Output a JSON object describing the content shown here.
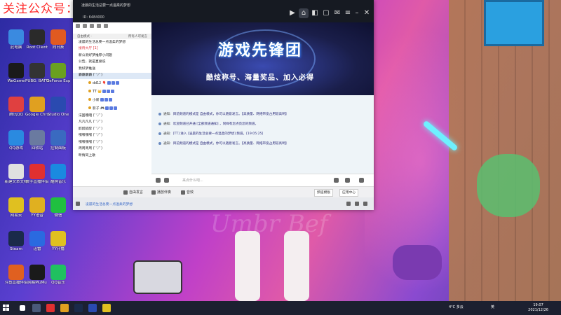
{
  "banner": {
    "text": "关注公众号：果佳兴，领红包买新鲜水果"
  },
  "desktop_icons": [
    {
      "label": "此电脑",
      "color": "#3a8ae0"
    },
    {
      "label": "Root Client",
      "color": "#2a2a2a"
    },
    {
      "label": "向日葵",
      "color": "#e05a20"
    },
    {
      "label": "WeGame",
      "color": "#1a1a1a"
    },
    {
      "label": "PUBG: BATTLEGR...",
      "color": "#333333"
    },
    {
      "label": "GeForce Experience",
      "color": "#6aa020"
    },
    {
      "label": "腾讯QQ",
      "color": "#e04040"
    },
    {
      "label": "Google Chrome",
      "color": "#e0a020"
    },
    {
      "label": "Studio One",
      "color": "#2a4ab0"
    },
    {
      "label": "QQ游戏",
      "color": "#2a8ae0"
    },
    {
      "label": "回收站",
      "color": "#6a7aa0"
    },
    {
      "label": "控制面板",
      "color": "#3a6ac0"
    },
    {
      "label": "新建文本文档",
      "color": "#e0e0e0"
    },
    {
      "label": "快手直播伴侣",
      "color": "#e03030"
    },
    {
      "label": "酷狗音乐",
      "color": "#1a8ae0"
    },
    {
      "label": "网易云",
      "color": "#e0c020"
    },
    {
      "label": "YY语音",
      "color": "#e0b020"
    },
    {
      "label": "微信",
      "color": "#20c040"
    },
    {
      "label": "Steam",
      "color": "#1a2a4a"
    },
    {
      "label": "迅雷",
      "color": "#2a6ae0"
    },
    {
      "label": "YY开播",
      "color": "#e0c020"
    },
    {
      "label": "斗鱼直播伴侣",
      "color": "#e06020"
    },
    {
      "label": "网易MuMu",
      "color": "#1a1a1a"
    },
    {
      "label": "QQ音乐",
      "color": "#20c060"
    }
  ],
  "window": {
    "room_name": "凌晨的生活总要一点温柔的梦想",
    "room_id": "ID:  6484000",
    "controls": [
      "play-icon",
      "home-icon",
      "gamepad-icon",
      "chat-icon",
      "mail-icon",
      "settings-icon",
      "minimize-icon",
      "maximize-icon",
      "close-icon"
    ]
  },
  "left_panel": {
    "mode_label": "自由模式 ·",
    "mode_right": "所有人可发言",
    "channels": [
      {
        "name": "凌晨的生活总要一点温柔的梦想",
        "type": "top"
      },
      {
        "name": "接待大厅 [1]",
        "type": "hot"
      },
      {
        "name": "新公测好梦推荐小问题",
        "type": "top"
      },
      {
        "name": "公告，就是直接说",
        "type": "top"
      },
      {
        "name": "我好梦推送",
        "type": "top"
      },
      {
        "name": "霸霸霸霸 (ﾟ▽ﾟ)",
        "type": "active"
      },
      {
        "name": "dd12 🎈",
        "type": "sub"
      },
      {
        "name": "TT 👑",
        "type": "sub"
      },
      {
        "name": "小新",
        "type": "sub"
      },
      {
        "name": "影子 🎮",
        "type": "sub"
      },
      {
        "name": "法国嘎嘎 (ﾟ▽ﾟ)",
        "type": "top"
      },
      {
        "name": "凡凡凡凡 (ﾟ▽ﾟ)",
        "type": "top"
      },
      {
        "name": "醉醉醉醉 (ﾟ▽ﾟ)",
        "type": "top"
      },
      {
        "name": "嘿嘿嘿嘿 (ﾟ▽ﾟ)",
        "type": "top"
      },
      {
        "name": "嘿嘿嘿嘿 (ﾟ▽ﾟ)",
        "type": "top"
      },
      {
        "name": "周周周周 (ﾟ▽ﾟ)",
        "type": "top"
      },
      {
        "name": "昕情同上歌",
        "type": "top"
      }
    ]
  },
  "game_banner": {
    "title": "游戏先锋团",
    "subtitle": "酷炫称号、海量奖品、加入必得"
  },
  "messages": [
    {
      "label": "通知:",
      "text": "目前频道的模式是 自由模式，你可以随意发言。【高质量、网络带宽占用较高哟】"
    },
    {
      "label": "通知:",
      "text": "欢迎频道已开通 [全部频道通知] ，同样有您点亮您的频道。"
    },
    {
      "label": "通知:",
      "text": "[TT] 进入 [凌晨的生活总要一点温柔的梦想] 频道。[19:05:25]"
    },
    {
      "label": "通知:",
      "text": "目前频道的模式是 自由模式，你可以随意发言。【高质量、网络带宽占用较高哟】"
    }
  ],
  "input": {
    "placeholder": "来点什么吧..."
  },
  "bottom_bar": {
    "free_speech": "自由发言",
    "play_accompany": "播放伴奏",
    "sound_effect": "音效",
    "channel_template": "频道模板",
    "apply_center": "应用中心"
  },
  "status_bar": {
    "text": "凌晨的生活总要一点温柔的梦想"
  },
  "scene_text": "Umbr Bef",
  "taskbar": {
    "weather": "4°C 多云",
    "ime": "英",
    "time": "19:07",
    "date": "2021/12/26"
  },
  "colors": {
    "banner_text": "#ff2a2a",
    "taskbar": "#1c2030",
    "title_bar": "#161a22"
  }
}
